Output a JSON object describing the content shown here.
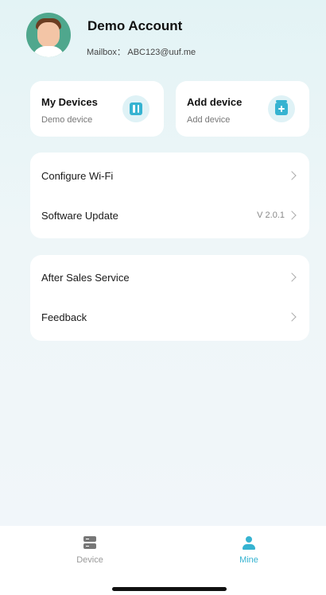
{
  "profile": {
    "name": "Demo Account",
    "mailbox": "Mailbox： ABC123@uuf.me"
  },
  "devices": {
    "my_devices": {
      "title": "My Devices",
      "subtitle": "Demo device",
      "icon": "device-icon"
    },
    "add_device": {
      "title": "Add device",
      "subtitle": "Add device",
      "icon": "add-box-icon"
    }
  },
  "settings": {
    "configure_wifi": "Configure Wi-Fi",
    "software_update": {
      "label": "Software Update",
      "version": "V 2.0.1"
    }
  },
  "support": {
    "after_sales": "After Sales Service",
    "feedback": "Feedback"
  },
  "tabs": {
    "device": "Device",
    "mine": "Mine",
    "active": "mine"
  },
  "colors": {
    "accent": "#36b3d1",
    "avatar_bg": "#4fa78d",
    "inactive_tab": "#9a9a9a"
  }
}
